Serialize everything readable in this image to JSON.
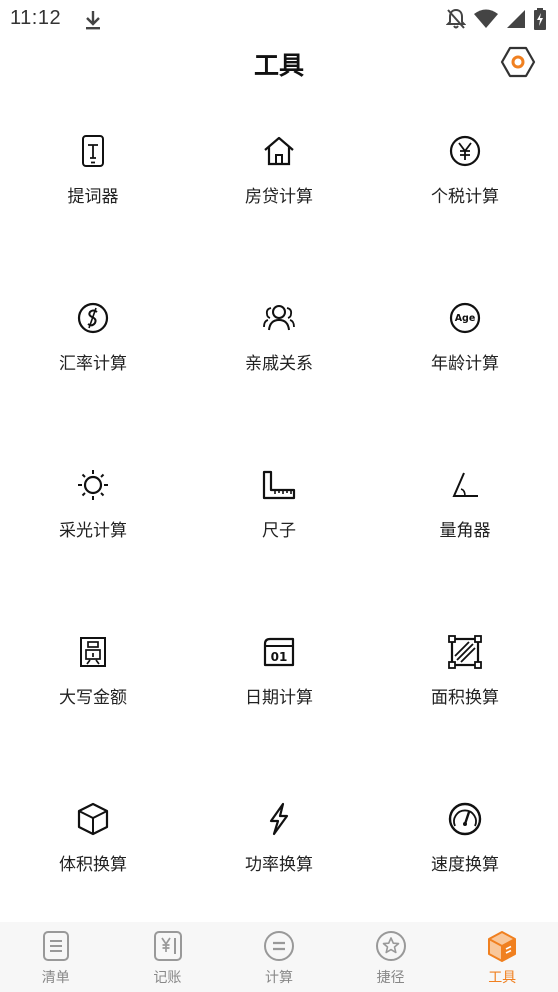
{
  "status_bar": {
    "time": "11:12",
    "icons": [
      "download-icon",
      "notifications-off-icon",
      "wifi-icon",
      "signal-icon",
      "battery-charging-icon"
    ]
  },
  "header": {
    "title": "工具",
    "settings_icon": "hexagon-settings-icon",
    "accent_color": "#f08020"
  },
  "tools": [
    {
      "label": "提词器",
      "icon": "teleprompter-icon"
    },
    {
      "label": "房贷计算",
      "icon": "house-icon"
    },
    {
      "label": "个税计算",
      "icon": "yen-circle-icon"
    },
    {
      "label": "汇率计算",
      "icon": "currency-exchange-icon"
    },
    {
      "label": "亲戚关系",
      "icon": "people-icon"
    },
    {
      "label": "年龄计算",
      "icon": "age-icon"
    },
    {
      "label": "采光计算",
      "icon": "sun-icon"
    },
    {
      "label": "尺子",
      "icon": "ruler-icon"
    },
    {
      "label": "量角器",
      "icon": "protractor-angle-icon"
    },
    {
      "label": "大写金额",
      "icon": "yuan-character-icon"
    },
    {
      "label": "日期计算",
      "icon": "calendar-icon"
    },
    {
      "label": "面积换算",
      "icon": "area-icon"
    },
    {
      "label": "体积换算",
      "icon": "cube-icon"
    },
    {
      "label": "功率换算",
      "icon": "lightning-icon"
    },
    {
      "label": "速度换算",
      "icon": "speedometer-icon"
    }
  ],
  "tabbar": {
    "active_index": 4,
    "tabs": [
      {
        "label": "清单",
        "icon": "list-document-icon"
      },
      {
        "label": "记账",
        "icon": "ledger-yen-icon"
      },
      {
        "label": "计算",
        "icon": "equals-circle-icon"
      },
      {
        "label": "捷径",
        "icon": "star-circle-icon"
      },
      {
        "label": "工具",
        "icon": "toolbox-cube-icon"
      }
    ]
  }
}
